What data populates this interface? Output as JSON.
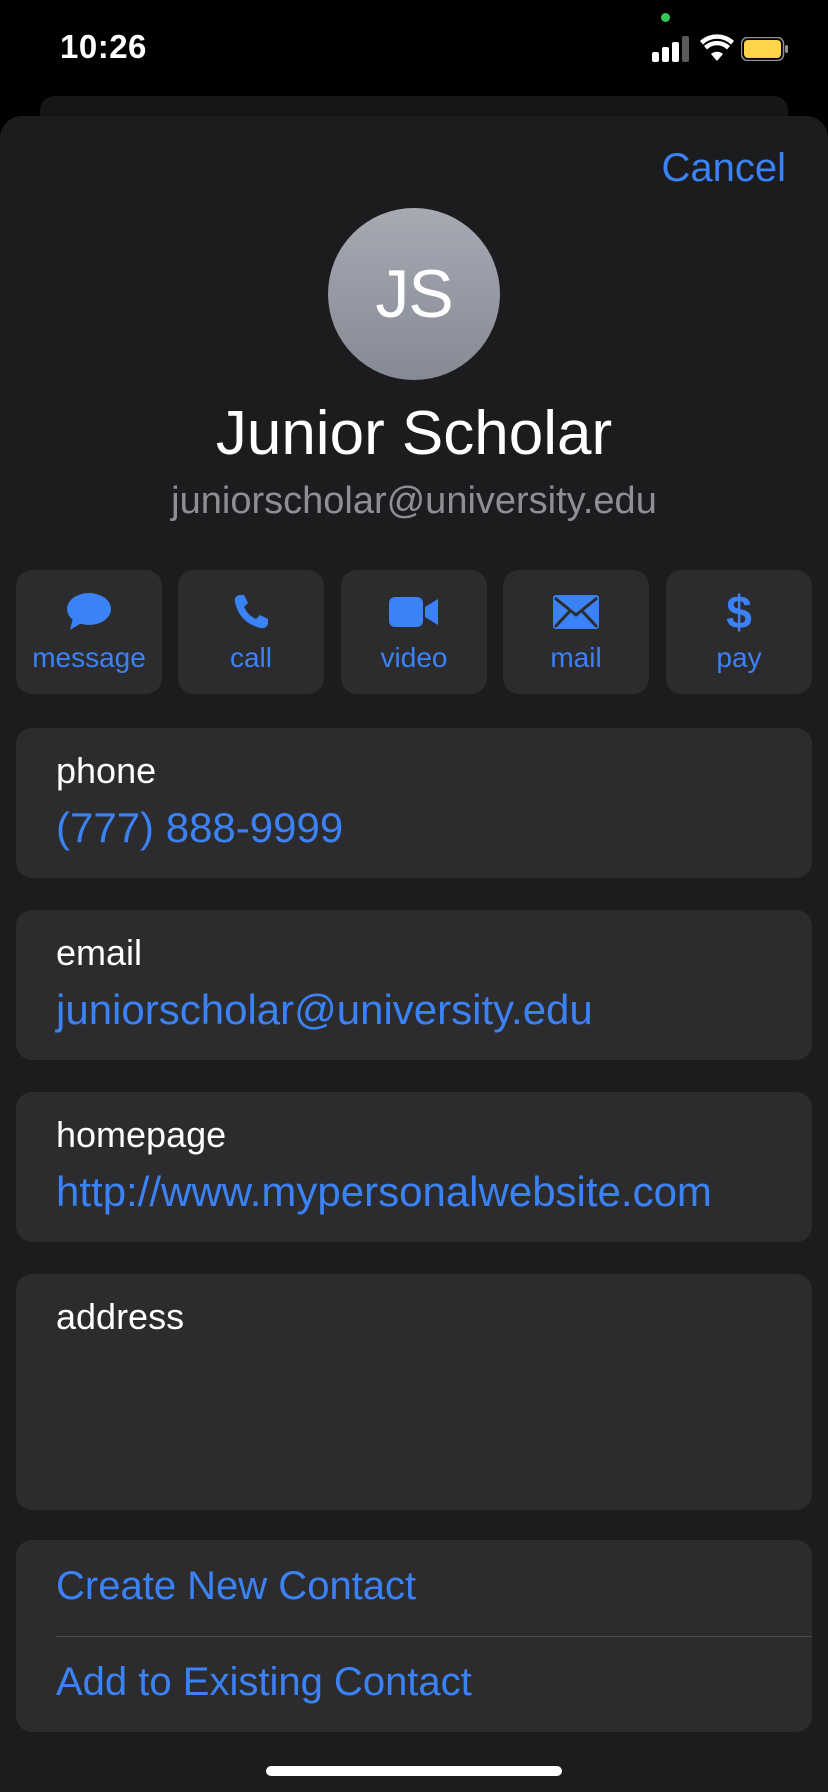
{
  "status_bar": {
    "time": "10:26",
    "battery_color": "#ffd54a"
  },
  "header": {
    "cancel_label": "Cancel"
  },
  "contact": {
    "initials": "JS",
    "name": "Junior Scholar",
    "subtitle": "juniorscholar@university.edu"
  },
  "actions": [
    {
      "label": "message",
      "icon": "message-bubble-icon"
    },
    {
      "label": "call",
      "icon": "phone-icon"
    },
    {
      "label": "video",
      "icon": "video-camera-icon"
    },
    {
      "label": "mail",
      "icon": "envelope-icon"
    },
    {
      "label": "pay",
      "icon": "dollar-icon"
    }
  ],
  "fields": {
    "phone": {
      "label": "phone",
      "value": "(777) 888-9999"
    },
    "email": {
      "label": "email",
      "value": "juniorscholar@university.edu"
    },
    "homepage": {
      "label": "homepage",
      "value": "http://www.mypersonalwebsite.com"
    },
    "address": {
      "label": "address",
      "value": ""
    }
  },
  "bottom": {
    "create_label": "Create New Contact",
    "add_existing_label": "Add to Existing Contact"
  },
  "colors": {
    "accent": "#3b82f6",
    "sheet": "#1c1c1e",
    "card": "#2c2c2e"
  }
}
